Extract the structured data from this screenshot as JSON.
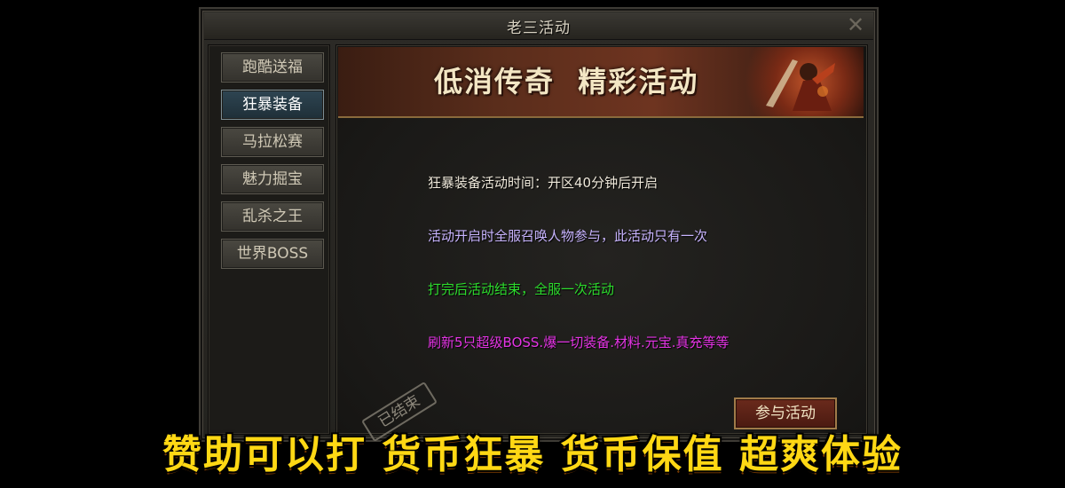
{
  "window": {
    "title": "老三活动",
    "close_glyph": "✕"
  },
  "sidebar": {
    "items": [
      {
        "label": "跑酷送福"
      },
      {
        "label": "狂暴装备"
      },
      {
        "label": "马拉松赛"
      },
      {
        "label": "魅力掘宝"
      },
      {
        "label": "乱杀之王"
      },
      {
        "label": "世界BOSS"
      }
    ],
    "active_index": 1
  },
  "banner": {
    "title": "低消传奇  精彩活动"
  },
  "content": {
    "lines": [
      {
        "text": "狂暴装备活动时间：开区40分钟后开启",
        "color": "#efe9db"
      },
      {
        "text": "活动开启时全服召唤人物参与，此活动只有一次",
        "color": "#c8b4ff"
      },
      {
        "text": "打完后活动结束，全服一次活动",
        "color": "#2ddc2d"
      },
      {
        "text": "刷新5只超级BOSS.爆一切装备.材料.元宝.真充等等",
        "color": "#e434e4"
      }
    ],
    "stamp": "已结束",
    "join_button": "参与活动"
  },
  "caption": "赞助可以打 货币狂暴 货币保值 超爽体验",
  "colors": {
    "caption": "#ffd814",
    "active_tab": "#2e4552",
    "button": "#6a2a1c"
  }
}
